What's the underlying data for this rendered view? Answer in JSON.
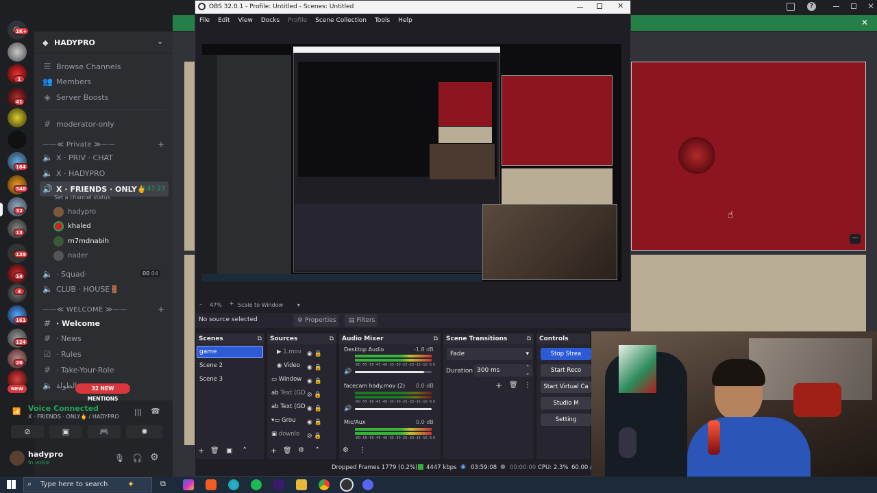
{
  "discord": {
    "server_badges": [
      "1K+",
      "1",
      "41",
      "164",
      "340",
      "32",
      "13",
      "139",
      "14",
      "4",
      "161",
      "124",
      "26",
      "NEW"
    ],
    "guild_name": "HADYPRO",
    "channels_top": [
      "Browse Channels",
      "Members",
      "Server Boosts"
    ],
    "moderator_channel": "moderator-only",
    "category_private": "——≪ Private ≫——",
    "private_channels": [
      "X · PRIV · CHAT",
      "X · HADYPRO",
      "X · FRIENDS · ONLY🖕"
    ],
    "active_timer": "3:47:23",
    "channel_status": "Set a channel status",
    "voice_users": [
      "hadypro",
      "khaled",
      "m7mdnabih",
      "nader"
    ],
    "squad_channel": "· Squad·",
    "squad_counts": [
      "00",
      "04"
    ],
    "club_channel": "CLUB · HOUSE🚪",
    "category_welcome": "——≪ WELCOME ≫——",
    "welcome_channels": [
      "· Welcome",
      "· News",
      "· Rules",
      "· Take-Your-Role"
    ],
    "arabic_channel": "الطولة",
    "mentions_pill": "32 NEW MENTIONS",
    "voice_connected": "Voice Connected",
    "voice_channel": "X · FRIENDS · ONLY🖕 / HADYPRO",
    "username": "hadypro",
    "user_status": "In voice"
  },
  "obs": {
    "title": "OBS 32.0.1 - Profile: Untitled - Scenes: Untitled",
    "menu": [
      "File",
      "Edit",
      "View",
      "Docks",
      "Profile",
      "Scene Collection",
      "Tools",
      "Help"
    ],
    "zoom": "47%",
    "scale_mode": "Scale to Window",
    "no_source": "No source selected",
    "properties": "Properties",
    "filters": "Filters",
    "scenes_title": "Scenes",
    "scenes": [
      "game",
      "Scene 2",
      "Scene 3"
    ],
    "sources_title": "Sources",
    "sources": [
      "1.mov",
      "Video",
      "Window",
      "Text (GD",
      "Text (GD",
      "Grou",
      "downlo"
    ],
    "mixer_title": "Audio Mixer",
    "mixer": [
      {
        "name": "Desktop Audio",
        "db": "-1.8 dB",
        "level": 0.85
      },
      {
        "name": "facecam hady.mov (2)",
        "db": "0.0 dB",
        "level": 0.6
      },
      {
        "name": "Mic/Aux",
        "db": "0.0 dB",
        "level": 0.8
      }
    ],
    "meter_scale": "-60 -55 -50 -45 -40 -35 -30 -25 -20 -15 -10 -5 0",
    "transitions_title": "Scene Transitions",
    "transition": "Fade",
    "duration_label": "Duration",
    "duration": "300 ms",
    "controls_title": "Controls",
    "controls": [
      "Stop Strea",
      "Start Reco",
      "Start Virtual Ca",
      "Studio M",
      "Setting"
    ],
    "status": {
      "dropped": "Dropped Frames 1779 (0.2%)",
      "bitrate": "4447 kbps",
      "stream_time": "03:59:08",
      "rec_time": "00:00:00",
      "cpu": "CPU: 2.3%",
      "fps": "60.00 /"
    }
  },
  "taskbar": {
    "search_placeholder": "Type here to search"
  },
  "colors": {
    "discord_bg": "#2b2d31",
    "obs_bg": "#1f1e24",
    "accent_blue": "#2d5bd6",
    "red_panel": "#8d1520",
    "notification_green": "#248046",
    "mention_red": "#da373c"
  }
}
